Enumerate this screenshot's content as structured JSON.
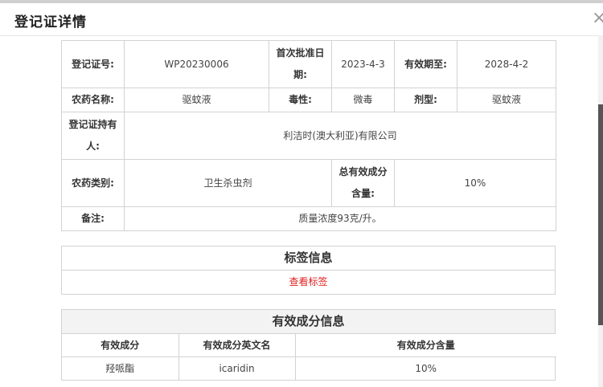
{
  "dialog": {
    "title": "登记证详情",
    "close_icon": "×"
  },
  "details": {
    "reg_no_label": "登记证号:",
    "reg_no_value": "WP20230006",
    "first_approval_label": "首次批准日期:",
    "first_approval_value": "2023-4-3",
    "valid_until_label": "有效期至:",
    "valid_until_value": "2028-4-2",
    "pesticide_name_label": "农药名称:",
    "pesticide_name_value": "驱蚊液",
    "toxicity_label": "毒性:",
    "toxicity_value": "微毒",
    "formulation_label": "剂型:",
    "formulation_value": "驱蚊液",
    "holder_label": "登记证持有人:",
    "holder_value": "利洁时(澳大利亚)有限公司",
    "category_label": "农药类别:",
    "category_value": "卫生杀虫剂",
    "total_content_label": "总有效成分含量:",
    "total_content_value": "10%",
    "remarks_label": "备注:",
    "remarks_value": "质量浓度93克/升。"
  },
  "label_section": {
    "title": "标签信息",
    "link_text": "查看标签"
  },
  "ingredients_section": {
    "title": "有效成分信息",
    "headers": [
      "有效成分",
      "有效成分英文名",
      "有效成分含量"
    ],
    "rows": [
      [
        "羟哌酯",
        "icaridin",
        "10%"
      ]
    ]
  }
}
